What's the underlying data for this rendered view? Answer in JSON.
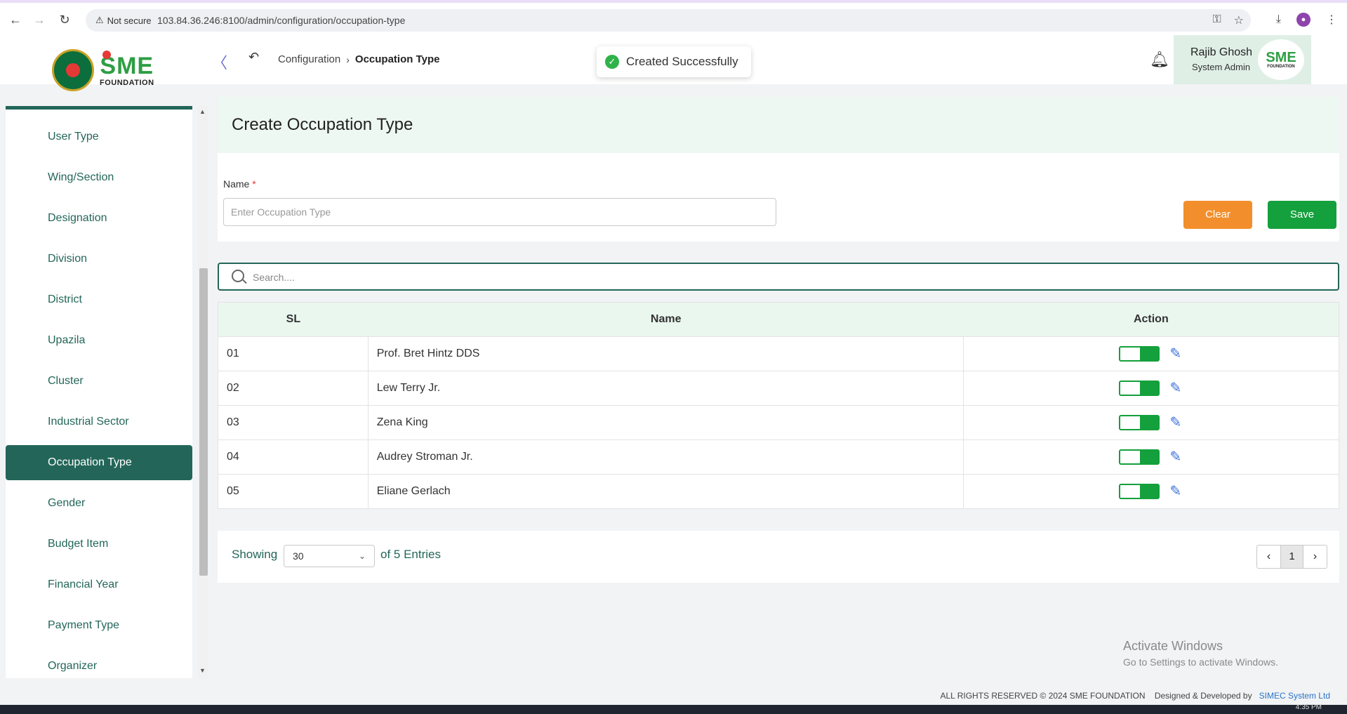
{
  "browser": {
    "security": "Not secure",
    "url": "103.84.36.246:8100/admin/configuration/occupation-type"
  },
  "header": {
    "logo_text": "SME",
    "logo_sub": "FOUNDATION",
    "breadcrumb": [
      "Configuration",
      "Occupation Type"
    ],
    "toast": "Created Successfully",
    "user_name": "Rajib Ghosh",
    "user_role": "System Admin"
  },
  "sidebar": {
    "items": [
      {
        "label": "User Type"
      },
      {
        "label": "Wing/Section"
      },
      {
        "label": "Designation"
      },
      {
        "label": "Division"
      },
      {
        "label": "District"
      },
      {
        "label": "Upazila"
      },
      {
        "label": "Cluster"
      },
      {
        "label": "Industrial Sector"
      },
      {
        "label": "Occupation Type",
        "active": true
      },
      {
        "label": "Gender"
      },
      {
        "label": "Budget Item"
      },
      {
        "label": "Financial Year"
      },
      {
        "label": "Payment Type"
      },
      {
        "label": "Organizer"
      }
    ]
  },
  "form": {
    "title": "Create Occupation Type",
    "name_label": "Name",
    "required_mark": "*",
    "name_placeholder": "Enter Occupation Type",
    "name_value": "",
    "clear_label": "Clear",
    "save_label": "Save"
  },
  "search": {
    "placeholder": "Search...."
  },
  "table": {
    "columns": [
      "SL",
      "Name",
      "Action"
    ],
    "rows": [
      {
        "sl": "01",
        "name": "Prof. Bret Hintz DDS",
        "active": true
      },
      {
        "sl": "02",
        "name": "Lew Terry Jr.",
        "active": true
      },
      {
        "sl": "03",
        "name": "Zena King",
        "active": true
      },
      {
        "sl": "04",
        "name": "Audrey Stroman Jr.",
        "active": true
      },
      {
        "sl": "05",
        "name": "Eliane Gerlach",
        "active": true
      }
    ]
  },
  "pagination": {
    "showing_label": "Showing",
    "page_size": "30",
    "entries_label": "of 5 Entries",
    "current_page": "1"
  },
  "watermark": {
    "title": "Activate Windows",
    "subtitle": "Go to Settings to activate Windows."
  },
  "footer": {
    "rights": "ALL RIGHTS RESERVED © 2024 SME FOUNDATION",
    "designed_by": "Designed & Developed by",
    "company": "SIMEC System Ltd"
  },
  "taskbar": {
    "clock": "4:35 PM"
  },
  "colors": {
    "primary": "#236659",
    "save": "#14a03c",
    "clear": "#f28f2c",
    "toggle_on": "#14a03c",
    "edit_icon": "#3a6ed8"
  }
}
